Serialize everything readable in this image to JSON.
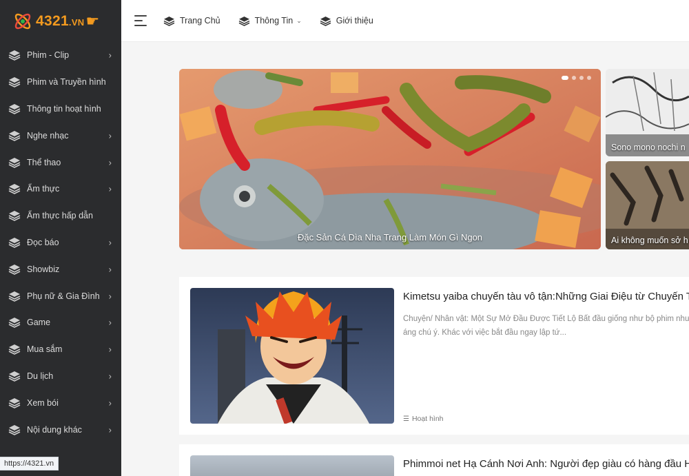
{
  "brand": {
    "name": "4321",
    "tld": ".VN",
    "logo_color": "#f39a1f"
  },
  "header": {
    "nav": [
      {
        "label": "Trang Chủ",
        "has_caret": false
      },
      {
        "label": "Thông Tin",
        "has_caret": true
      },
      {
        "label": "Giới thiệu",
        "has_caret": false
      }
    ]
  },
  "sidebar": {
    "items": [
      {
        "label": "Phim - Clip",
        "has_chevron": true
      },
      {
        "label": "Phim và Truyền hình",
        "has_chevron": false
      },
      {
        "label": "Thông tin hoạt hình",
        "has_chevron": false
      },
      {
        "label": "Nghe nhạc",
        "has_chevron": true
      },
      {
        "label": "Thể thao",
        "has_chevron": true
      },
      {
        "label": "Ẩm thực",
        "has_chevron": true
      },
      {
        "label": "Ẩm thực hấp dẫn",
        "has_chevron": false
      },
      {
        "label": "Đọc báo",
        "has_chevron": true
      },
      {
        "label": "Showbiz",
        "has_chevron": true
      },
      {
        "label": "Phụ nữ & Gia Đình",
        "has_chevron": true
      },
      {
        "label": "Game",
        "has_chevron": true
      },
      {
        "label": "Mua sắm",
        "has_chevron": true
      },
      {
        "label": "Du lịch",
        "has_chevron": true
      },
      {
        "label": "Xem bói",
        "has_chevron": true
      },
      {
        "label": "Nội dung khác",
        "has_chevron": true
      }
    ]
  },
  "slider": {
    "main_caption": "Đặc Sản Cá Dìa Nha Trang Làm Món Gì Ngon",
    "side": [
      {
        "caption": "Sono mono nochi n"
      },
      {
        "caption": "Ai không muốn sở h"
      }
    ]
  },
  "articles": [
    {
      "title": "Kimetsu yaiba chuyến tàu vô tận:Những Giai Điệu từ Chuyến T",
      "desc_line1": "Chuyện/ Nhân vật: Một Sự Mở Đầu Được Tiết Lộ Bất đầu giống như bộ phim như",
      "desc_line2": "áng chú ý. Khác với việc bắt đầu ngay lập tứ...",
      "category": "Hoạt hình"
    },
    {
      "title": "Phimmoi net Hạ Cánh Nơi Anh: Người đẹp giàu có hàng đầu H"
    }
  ],
  "status_bar": {
    "url": "https://4321.vn"
  }
}
